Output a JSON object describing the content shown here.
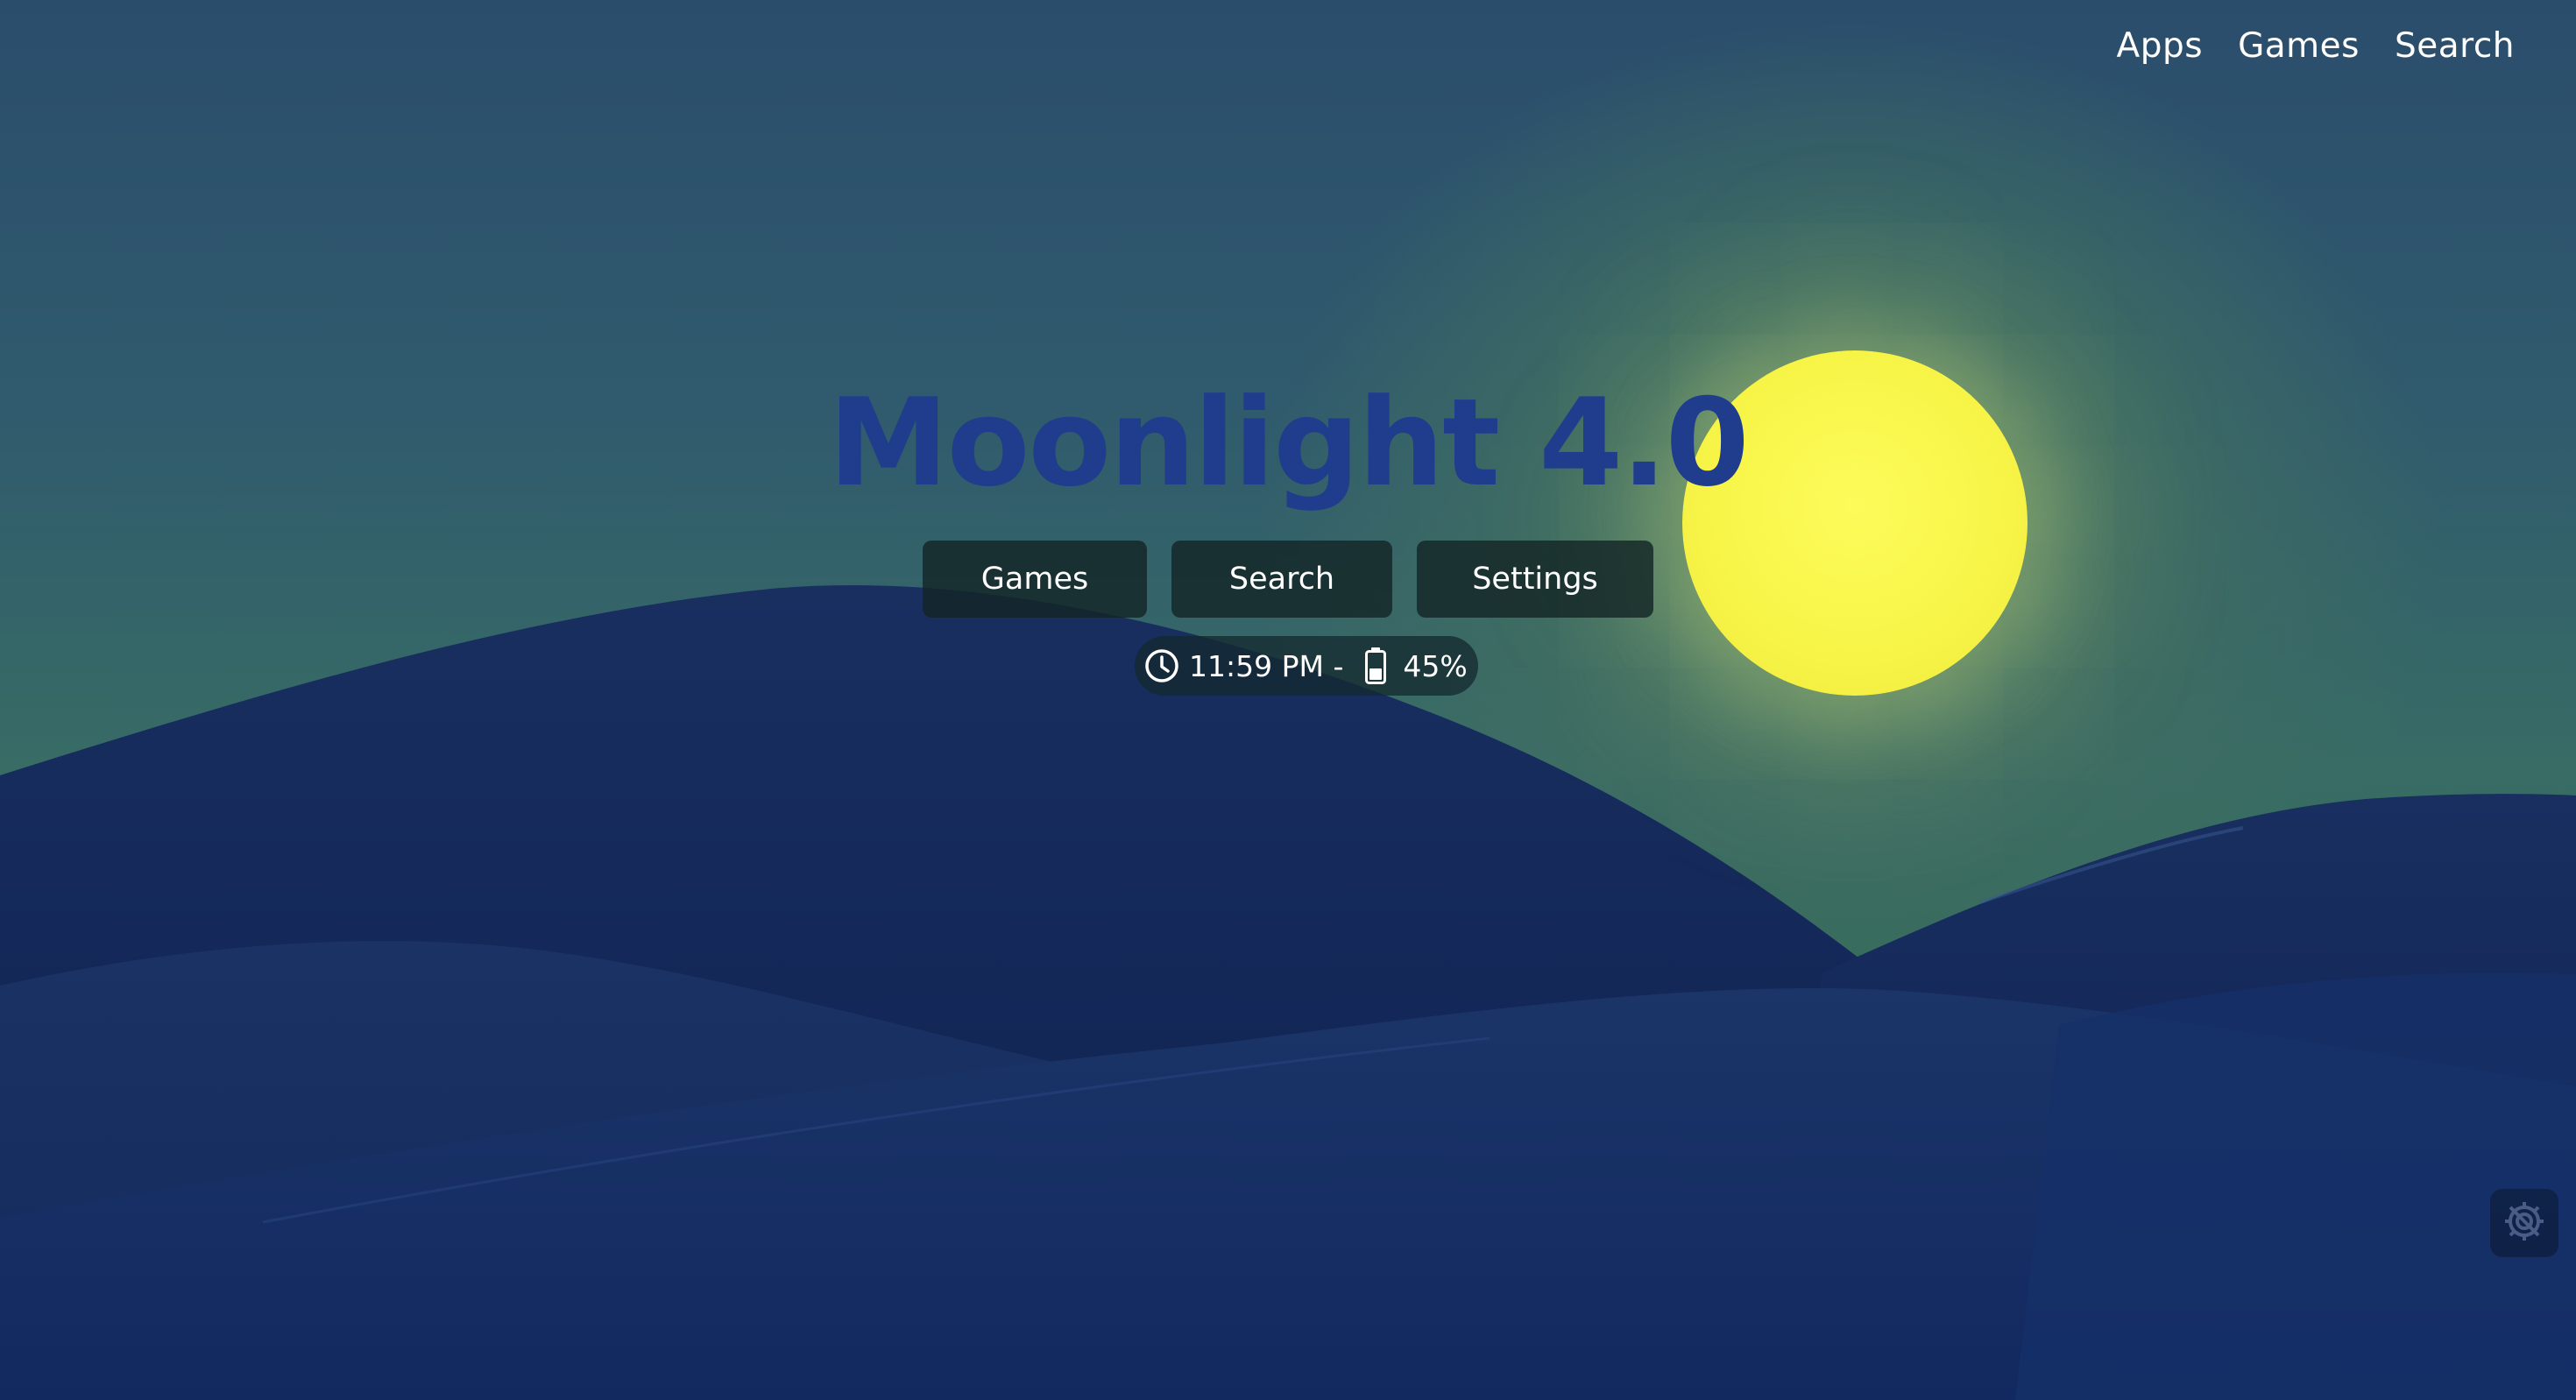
{
  "nav": {
    "apps_label": "Apps",
    "games_label": "Games",
    "search_label": "Search"
  },
  "hero": {
    "title": "Moonlight 4.0"
  },
  "actions": {
    "games_label": "Games",
    "search_label": "Search",
    "settings_label": "Settings"
  },
  "status": {
    "time_text": "11:59 PM -",
    "battery_text": "45%",
    "battery_level": 0.45,
    "clock_icon": "clock-icon",
    "battery_icon": "battery-icon"
  },
  "corner": {
    "icon": "gear-off-icon"
  },
  "colors": {
    "title": "#1f3d8c",
    "sun": "#f7f447",
    "button_bg": "#142626",
    "dunes": "#14275a"
  }
}
